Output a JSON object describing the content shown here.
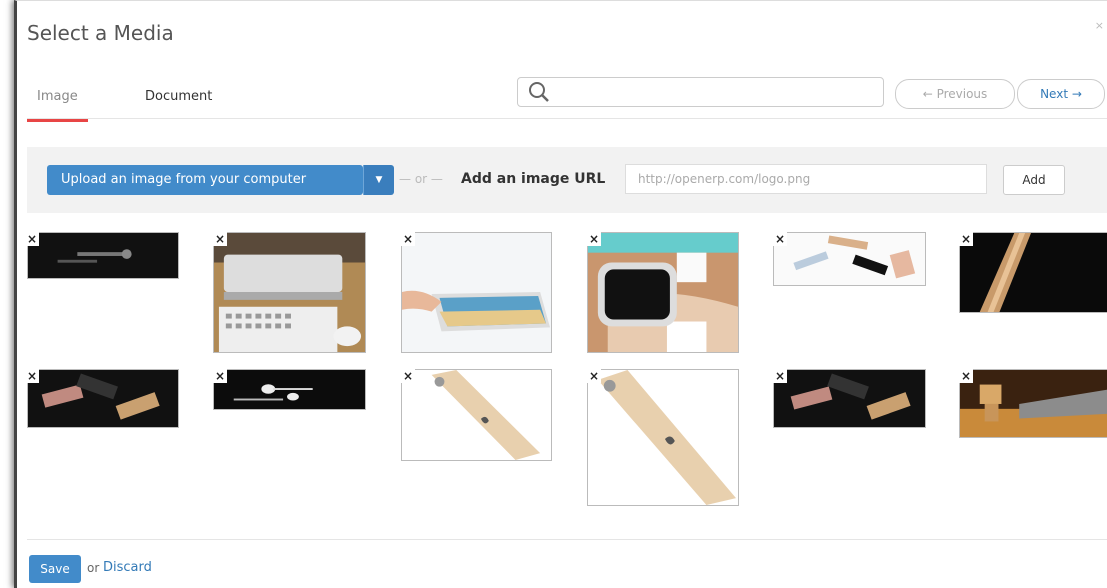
{
  "modal": {
    "title": "Select a Media",
    "close_label": "×"
  },
  "tabs": [
    {
      "label": "Image",
      "active": true
    },
    {
      "label": "Document",
      "active": false
    }
  ],
  "search": {
    "value": "",
    "placeholder": ""
  },
  "pager": {
    "previous_label": "← Previous",
    "next_label": "Next →"
  },
  "upload": {
    "button_label": "Upload an image from your computer",
    "caret": "▼",
    "or_separator": "— or —",
    "url_label": "Add an image URL",
    "url_placeholder": "http://openerp.com/logo.png",
    "add_label": "Add"
  },
  "thumbnails": [
    {
      "name": "earbuds-black",
      "delete_label": "×"
    },
    {
      "name": "mac-mini-keyboard",
      "delete_label": "×"
    },
    {
      "name": "tablet-hand",
      "delete_label": "×"
    },
    {
      "name": "smartwatch-wrist",
      "delete_label": "×"
    },
    {
      "name": "phones-floating",
      "delete_label": "×"
    },
    {
      "name": "phone-gold-dark",
      "delete_label": "×"
    },
    {
      "name": "phones-rose-gold",
      "delete_label": "×"
    },
    {
      "name": "earpods-white",
      "delete_label": "×"
    },
    {
      "name": "iphone-gold-back",
      "delete_label": "×"
    },
    {
      "name": "iphone-gold-back-large",
      "delete_label": "×"
    },
    {
      "name": "phones-dark-trio",
      "delete_label": "×"
    },
    {
      "name": "wooden-figure-laptop",
      "delete_label": "×"
    }
  ],
  "footer": {
    "save_label": "Save",
    "or_label": "or",
    "discard_label": "Discard"
  },
  "colors": {
    "primary": "#428bca",
    "tab_active": "#e84545",
    "link": "#337ab7"
  }
}
